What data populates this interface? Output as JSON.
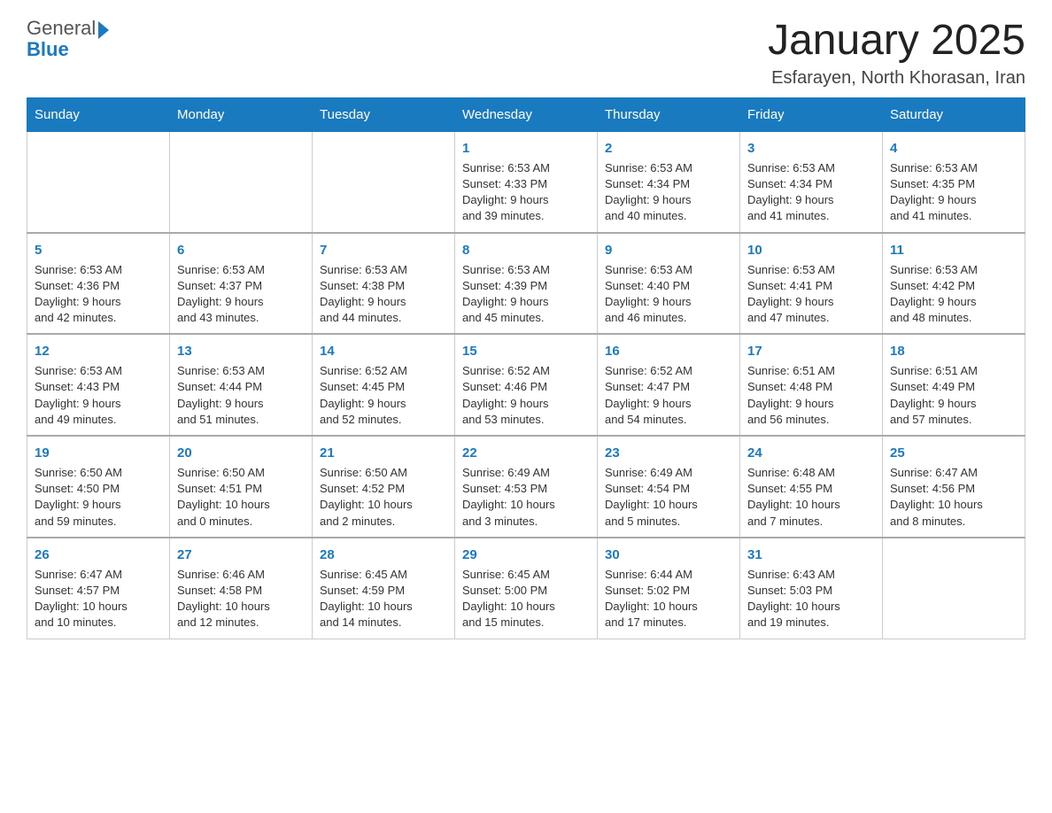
{
  "header": {
    "logo_general": "General",
    "logo_blue": "Blue",
    "month_title": "January 2025",
    "location": "Esfarayen, North Khorasan, Iran"
  },
  "calendar": {
    "days_of_week": [
      "Sunday",
      "Monday",
      "Tuesday",
      "Wednesday",
      "Thursday",
      "Friday",
      "Saturday"
    ],
    "weeks": [
      [
        {
          "day": "",
          "info": ""
        },
        {
          "day": "",
          "info": ""
        },
        {
          "day": "",
          "info": ""
        },
        {
          "day": "1",
          "info": "Sunrise: 6:53 AM\nSunset: 4:33 PM\nDaylight: 9 hours\nand 39 minutes."
        },
        {
          "day": "2",
          "info": "Sunrise: 6:53 AM\nSunset: 4:34 PM\nDaylight: 9 hours\nand 40 minutes."
        },
        {
          "day": "3",
          "info": "Sunrise: 6:53 AM\nSunset: 4:34 PM\nDaylight: 9 hours\nand 41 minutes."
        },
        {
          "day": "4",
          "info": "Sunrise: 6:53 AM\nSunset: 4:35 PM\nDaylight: 9 hours\nand 41 minutes."
        }
      ],
      [
        {
          "day": "5",
          "info": "Sunrise: 6:53 AM\nSunset: 4:36 PM\nDaylight: 9 hours\nand 42 minutes."
        },
        {
          "day": "6",
          "info": "Sunrise: 6:53 AM\nSunset: 4:37 PM\nDaylight: 9 hours\nand 43 minutes."
        },
        {
          "day": "7",
          "info": "Sunrise: 6:53 AM\nSunset: 4:38 PM\nDaylight: 9 hours\nand 44 minutes."
        },
        {
          "day": "8",
          "info": "Sunrise: 6:53 AM\nSunset: 4:39 PM\nDaylight: 9 hours\nand 45 minutes."
        },
        {
          "day": "9",
          "info": "Sunrise: 6:53 AM\nSunset: 4:40 PM\nDaylight: 9 hours\nand 46 minutes."
        },
        {
          "day": "10",
          "info": "Sunrise: 6:53 AM\nSunset: 4:41 PM\nDaylight: 9 hours\nand 47 minutes."
        },
        {
          "day": "11",
          "info": "Sunrise: 6:53 AM\nSunset: 4:42 PM\nDaylight: 9 hours\nand 48 minutes."
        }
      ],
      [
        {
          "day": "12",
          "info": "Sunrise: 6:53 AM\nSunset: 4:43 PM\nDaylight: 9 hours\nand 49 minutes."
        },
        {
          "day": "13",
          "info": "Sunrise: 6:53 AM\nSunset: 4:44 PM\nDaylight: 9 hours\nand 51 minutes."
        },
        {
          "day": "14",
          "info": "Sunrise: 6:52 AM\nSunset: 4:45 PM\nDaylight: 9 hours\nand 52 minutes."
        },
        {
          "day": "15",
          "info": "Sunrise: 6:52 AM\nSunset: 4:46 PM\nDaylight: 9 hours\nand 53 minutes."
        },
        {
          "day": "16",
          "info": "Sunrise: 6:52 AM\nSunset: 4:47 PM\nDaylight: 9 hours\nand 54 minutes."
        },
        {
          "day": "17",
          "info": "Sunrise: 6:51 AM\nSunset: 4:48 PM\nDaylight: 9 hours\nand 56 minutes."
        },
        {
          "day": "18",
          "info": "Sunrise: 6:51 AM\nSunset: 4:49 PM\nDaylight: 9 hours\nand 57 minutes."
        }
      ],
      [
        {
          "day": "19",
          "info": "Sunrise: 6:50 AM\nSunset: 4:50 PM\nDaylight: 9 hours\nand 59 minutes."
        },
        {
          "day": "20",
          "info": "Sunrise: 6:50 AM\nSunset: 4:51 PM\nDaylight: 10 hours\nand 0 minutes."
        },
        {
          "day": "21",
          "info": "Sunrise: 6:50 AM\nSunset: 4:52 PM\nDaylight: 10 hours\nand 2 minutes."
        },
        {
          "day": "22",
          "info": "Sunrise: 6:49 AM\nSunset: 4:53 PM\nDaylight: 10 hours\nand 3 minutes."
        },
        {
          "day": "23",
          "info": "Sunrise: 6:49 AM\nSunset: 4:54 PM\nDaylight: 10 hours\nand 5 minutes."
        },
        {
          "day": "24",
          "info": "Sunrise: 6:48 AM\nSunset: 4:55 PM\nDaylight: 10 hours\nand 7 minutes."
        },
        {
          "day": "25",
          "info": "Sunrise: 6:47 AM\nSunset: 4:56 PM\nDaylight: 10 hours\nand 8 minutes."
        }
      ],
      [
        {
          "day": "26",
          "info": "Sunrise: 6:47 AM\nSunset: 4:57 PM\nDaylight: 10 hours\nand 10 minutes."
        },
        {
          "day": "27",
          "info": "Sunrise: 6:46 AM\nSunset: 4:58 PM\nDaylight: 10 hours\nand 12 minutes."
        },
        {
          "day": "28",
          "info": "Sunrise: 6:45 AM\nSunset: 4:59 PM\nDaylight: 10 hours\nand 14 minutes."
        },
        {
          "day": "29",
          "info": "Sunrise: 6:45 AM\nSunset: 5:00 PM\nDaylight: 10 hours\nand 15 minutes."
        },
        {
          "day": "30",
          "info": "Sunrise: 6:44 AM\nSunset: 5:02 PM\nDaylight: 10 hours\nand 17 minutes."
        },
        {
          "day": "31",
          "info": "Sunrise: 6:43 AM\nSunset: 5:03 PM\nDaylight: 10 hours\nand 19 minutes."
        },
        {
          "day": "",
          "info": ""
        }
      ]
    ]
  }
}
